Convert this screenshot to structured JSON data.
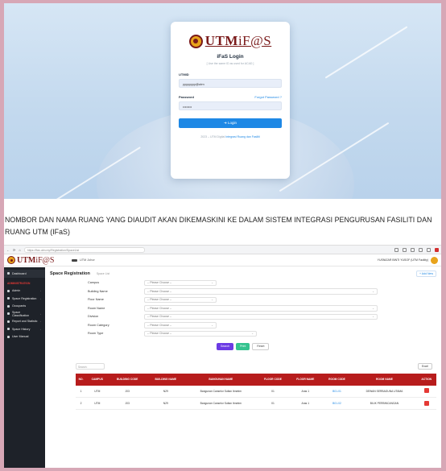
{
  "login": {
    "title": "iFaS Login",
    "subtitle": "[ Use the same ID as used for ACAD ]",
    "username_label": "UTMID",
    "username_value": "yyyyyyyy@utm",
    "password_label": "Password",
    "forgot_link": "Forgot Password ?",
    "password_value": "••••••••",
    "login_button": "➜ Login",
    "footer_prefix": "2023 – UTM Digital",
    "footer_link": "Integrasi Ruang dan Fasiliti"
  },
  "caption": "NOMBOR DAN NAMA RUANG YANG DIAUDIT AKAN DIKEMASKINI KE DALAM SISTEM INTEGRASI PENGURUSAN FASILITI DAN RUANG UTM (IFaS)",
  "logo": {
    "brand": "UTM",
    "brand_suffix": "iF@S"
  },
  "browser": {
    "url": "https://ifas.utm.my/Registration/SpaceList"
  },
  "app": {
    "campus_label": "UTM Johor",
    "user": "YUSNIZAR BINTI YUSOF (UTM Facility)",
    "sidebar": {
      "dashboard": "Dashboard",
      "section": "ADMINISTRATION",
      "items": [
        "Admin",
        "Space Registration",
        "Occupants",
        "Space Classification",
        "Report and Statistic",
        "Space History",
        "User Manual"
      ]
    },
    "page_title": "Space Registration",
    "page_crumb": "Space List",
    "head_button": "+ Add New",
    "form": [
      {
        "label": "Campus",
        "value": "-- Please Choose --"
      },
      {
        "label": "Building Name",
        "value": "-- Please Choose --"
      },
      {
        "label": "Floor Name",
        "value": "-- Please Choose --"
      },
      {
        "label": "Room Name",
        "value": "-- Please Choose --"
      },
      {
        "label": "Division",
        "value": "-- Please Choose --"
      },
      {
        "label": "Room Category",
        "value": "-- Please Choose --"
      },
      {
        "label": "Room Type",
        "value": "-- Please Choose --"
      }
    ],
    "buttons": {
      "search": "Search",
      "print": "Print",
      "reset": "Reset"
    },
    "table": {
      "search_placeholder": "Search:",
      "excel": "Excel",
      "headers": [
        "NO.",
        "CAMPUS",
        "BUILDING CODE",
        "BUILDING NAME",
        "BANGUNAN NAME",
        "FLOOR CODE",
        "FLOOR NAME",
        "ROOM CODE",
        "ROOM NAME",
        "ACTION"
      ],
      "rows": [
        [
          "1",
          "UTM",
          "J03",
          "N29",
          "Bangunan Canselor Sultan Ibrahim",
          "01",
          "Aras 1",
          "B01-01",
          "DEWAN SERBAGUNA UTAMA",
          ""
        ],
        [
          "2",
          "UTM",
          "J03",
          "N29",
          "Bangunan Canselor Sultan Ibrahim",
          "01",
          "Aras 1",
          "B01-02",
          "BILIK PERBINCANGAN",
          ""
        ]
      ]
    }
  },
  "colors": {
    "accent": "#b71c1c",
    "link": "#1e88e5",
    "sidebar": "#1e2229",
    "brand": "#7a1a1a"
  }
}
